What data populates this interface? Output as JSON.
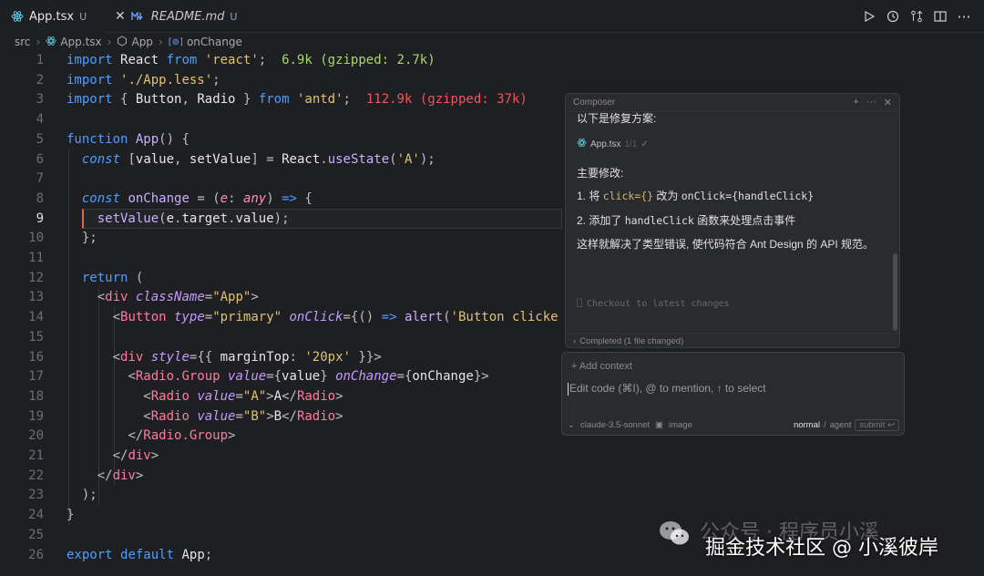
{
  "tabs": [
    {
      "label": "App.tsx",
      "status": "U"
    },
    {
      "label": "README.md",
      "status": "U"
    }
  ],
  "breadcrumb": [
    "src",
    "App.tsx",
    "App",
    "onChange"
  ],
  "editor": {
    "current_line": 9,
    "line_numbers": [
      "1",
      "2",
      "3",
      "4",
      "5",
      "6",
      "7",
      "8",
      "9",
      "10",
      "11",
      "12",
      "13",
      "14",
      "15",
      "16",
      "17",
      "18",
      "19",
      "20",
      "21",
      "22",
      "23",
      "24",
      "25",
      "26"
    ],
    "import_hints": {
      "react": "6.9k (gzipped: 2.7k)",
      "antd": "112.9k (gzipped: 37k)"
    }
  },
  "composer": {
    "title": "Composer",
    "intro": "以下是修复方案:",
    "file_chip": "App.tsx",
    "file_chip_meta": "1/1",
    "changes_heading": "主要修改:",
    "change1_prefix": "1. 将 ",
    "change1_code_a": "click={}",
    "change1_mid": " 改为 ",
    "change1_code_b": "onClick={handleClick}",
    "change2_prefix": "2. 添加了 ",
    "change2_code": "handleClick",
    "change2_suffix": " 函数来处理点击事件",
    "summary": "这样就解决了类型错误, 使代码符合 Ant Design 的 API 规范。",
    "checkout": "Checkout to latest changes",
    "completed": "Completed (1 file changed)"
  },
  "input": {
    "add_context": "+ Add context",
    "placeholder": "Edit code (⌘I), @ to mention, ↑ to select",
    "model": "claude-3.5-sonnet",
    "image": "image",
    "mode_normal": "normal",
    "mode_sep": "/",
    "mode_agent": "agent",
    "submit": "submit"
  },
  "watermark": {
    "top": "公众号 · 程序员小溪",
    "bottom": "掘金技术社区 @ 小溪彼岸"
  },
  "colors": {
    "background": "#1e1f22",
    "keyword": "#4f9dff",
    "string": "#e0c273",
    "tag": "#ff7b9c",
    "import_size_small": "#a7d86b",
    "import_size_large": "#f0565b"
  }
}
